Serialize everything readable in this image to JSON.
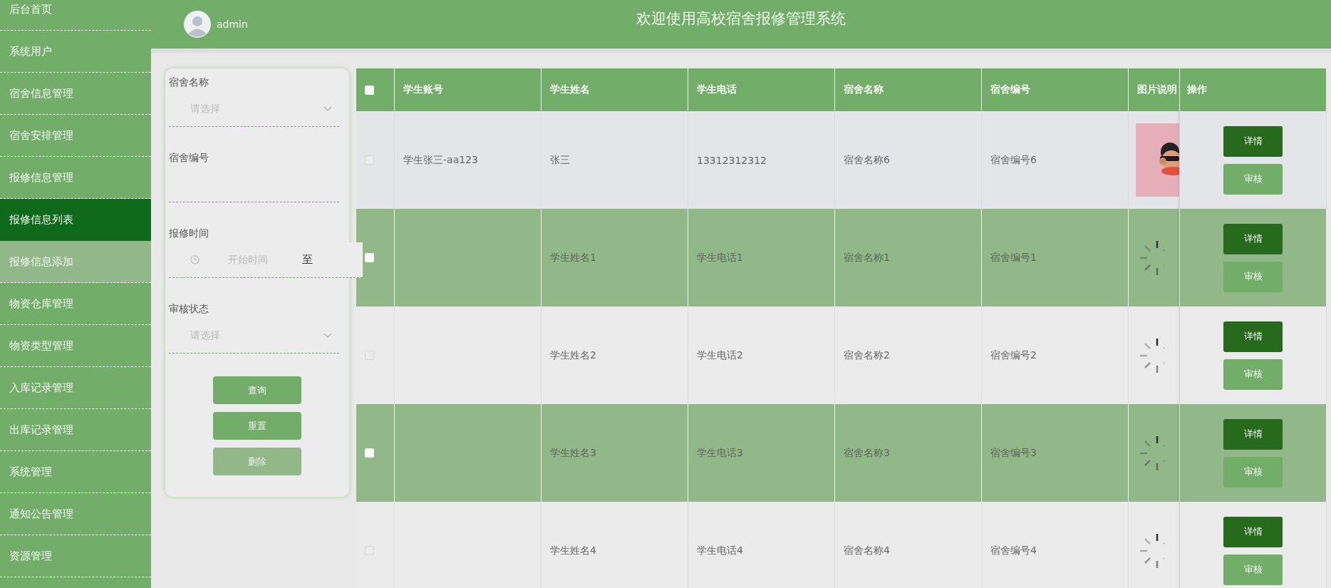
{
  "sidebar": {
    "items": [
      {
        "label": "后台首页",
        "selected": false,
        "highlighted": false
      },
      {
        "label": "系统用户",
        "selected": false,
        "highlighted": false
      },
      {
        "label": "宿舍信息管理",
        "selected": false,
        "highlighted": false
      },
      {
        "label": "宿舍安排管理",
        "selected": false,
        "highlighted": false
      },
      {
        "label": "报修信息管理",
        "selected": false,
        "highlighted": false
      },
      {
        "label": "报修信息列表",
        "selected": true,
        "highlighted": false
      },
      {
        "label": "报修信息添加",
        "selected": false,
        "highlighted": true
      },
      {
        "label": "物资仓库管理",
        "selected": false,
        "highlighted": false
      },
      {
        "label": "物资类型管理",
        "selected": false,
        "highlighted": false
      },
      {
        "label": "入库记录管理",
        "selected": false,
        "highlighted": false
      },
      {
        "label": "出库记录管理",
        "selected": false,
        "highlighted": false
      },
      {
        "label": "系统管理",
        "selected": false,
        "highlighted": false
      },
      {
        "label": "通知公告管理",
        "selected": false,
        "highlighted": false
      },
      {
        "label": "资源管理",
        "selected": false,
        "highlighted": false
      }
    ]
  },
  "header": {
    "username": "admin",
    "title": "欢迎使用高校宿舍报修管理系统"
  },
  "filters": {
    "fields": [
      {
        "kind": "select",
        "label": "宿舍名称",
        "placeholder": "请选择"
      },
      {
        "kind": "text",
        "label": "宿舍编号"
      },
      {
        "kind": "daterange",
        "label": "报修时间",
        "placeholder": "开始时间",
        "separator": "至"
      },
      {
        "kind": "select",
        "label": "审核状态",
        "placeholder": "请选择"
      }
    ],
    "buttons": [
      {
        "label": "查询",
        "disabled": false
      },
      {
        "label": "重置",
        "disabled": false
      },
      {
        "label": "删除",
        "disabled": true
      }
    ]
  },
  "table": {
    "select_all": {
      "checked": false
    },
    "columns": [
      "学生账号",
      "学生姓名",
      "学生电话",
      "宿舍名称",
      "宿舍编号",
      "图片说明",
      "操作"
    ],
    "rows": [
      {
        "checked": false,
        "account": "学生张三-aa123",
        "name": "张三",
        "phone": "13312312312",
        "dorm_name": "宿舍名称6",
        "dorm_no": "宿舍编号6",
        "image": {
          "kind": "picture"
        },
        "actions": [
          "详情",
          "审核"
        ]
      },
      {
        "checked": false,
        "name": "学生姓名1",
        "phone": "学生电话1",
        "dorm_name": "宿舍名称1",
        "dorm_no": "宿舍编号1",
        "image": {
          "kind": "loading"
        },
        "actions": [
          "详情",
          "审核"
        ]
      },
      {
        "checked": false,
        "name": "学生姓名2",
        "phone": "学生电话2",
        "dorm_name": "宿舍名称2",
        "dorm_no": "宿舍编号2",
        "image": {
          "kind": "loading"
        },
        "actions": [
          "详情",
          "审核"
        ]
      },
      {
        "checked": false,
        "name": "学生姓名3",
        "phone": "学生电话3",
        "dorm_name": "宿舍名称3",
        "dorm_no": "宿舍编号3",
        "image": {
          "kind": "loading"
        },
        "actions": [
          "详情",
          "审核"
        ]
      },
      {
        "checked": false,
        "name": "学生姓名4",
        "phone": "学生电话4",
        "dorm_name": "宿舍名称4",
        "dorm_no": "宿舍编号4",
        "image": {
          "kind": "loading"
        },
        "actions": [
          "详情",
          "审核"
        ]
      }
    ]
  }
}
